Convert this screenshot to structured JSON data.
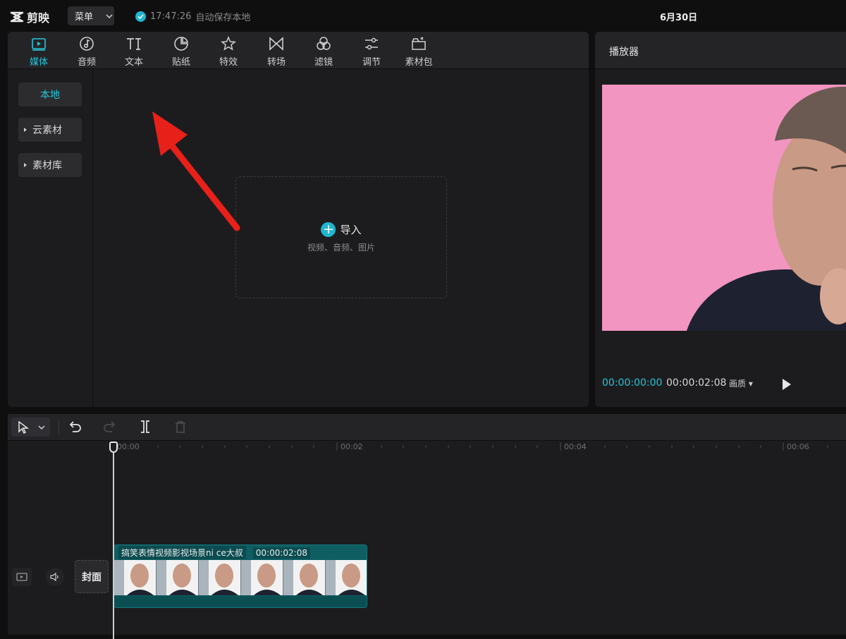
{
  "app": {
    "name": "剪映",
    "menu_label": "菜单",
    "autosave_time": "17:47:26",
    "autosave_text": "自动保存本地",
    "project_title": "6月30日"
  },
  "tabs": [
    {
      "label": "媒体",
      "icon": "media-icon"
    },
    {
      "label": "音频",
      "icon": "audio-icon"
    },
    {
      "label": "文本",
      "icon": "text-icon"
    },
    {
      "label": "贴纸",
      "icon": "sticker-icon"
    },
    {
      "label": "特效",
      "icon": "effects-icon"
    },
    {
      "label": "转场",
      "icon": "transition-icon"
    },
    {
      "label": "滤镜",
      "icon": "filter-icon"
    },
    {
      "label": "调节",
      "icon": "adjust-icon"
    },
    {
      "label": "素材包",
      "icon": "asset-pack-icon"
    }
  ],
  "sidebar": {
    "items": [
      "本地",
      "云素材",
      "素材库"
    ]
  },
  "import": {
    "label": "导入",
    "hint": "视频、音频、图片"
  },
  "player": {
    "title": "播放器",
    "current_time": "00:00:00:00",
    "total_time": "00:00:02:08",
    "quality_label": "画质"
  },
  "timeline": {
    "ticks": [
      "00:00",
      "00:02",
      "00:04",
      "00:06"
    ],
    "cover_label": "封面",
    "clip": {
      "name": "搞笑表情视频影视场景ni ce大叔",
      "duration": "00:00:02:08"
    }
  },
  "colors": {
    "accent": "#26c6da",
    "preview_bg": "#f295c0",
    "clip_bg": "#0e5e62",
    "annotation_arrow": "#e8201a"
  }
}
